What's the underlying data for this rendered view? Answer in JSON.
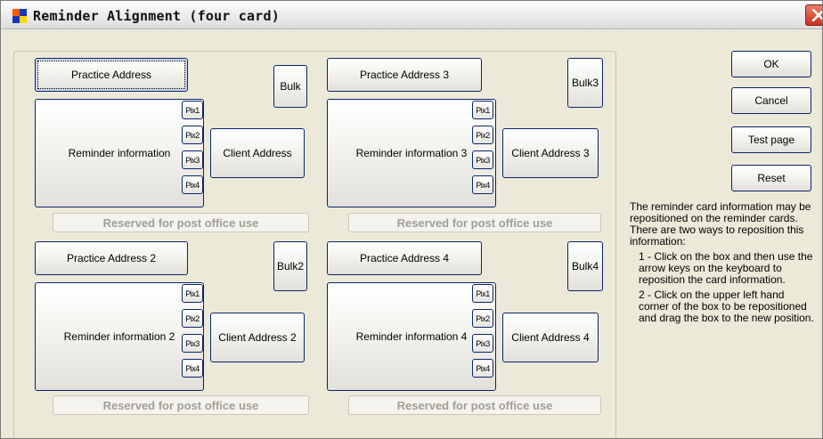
{
  "window": {
    "title": "Reminder Alignment (four card)"
  },
  "cards": [
    {
      "practice_address": "Practice Address",
      "bulk": "Bulk",
      "reminder_info": "Reminder information",
      "client_address": "Client Address",
      "pix": [
        "Pix1",
        "Pix2",
        "Pix3",
        "Pix4"
      ],
      "reserved": "Reserved for post office use"
    },
    {
      "practice_address": "Practice Address 3",
      "bulk": "Bulk3",
      "reminder_info": "Reminder information 3",
      "client_address": "Client Address 3",
      "pix": [
        "Pix1",
        "Pix2",
        "Pix3",
        "Pix4"
      ],
      "reserved": "Reserved for post office use"
    },
    {
      "practice_address": "Practice Address 2",
      "bulk": "Bulk2",
      "reminder_info": "Reminder information 2",
      "client_address": "Client Address 2",
      "pix": [
        "Pix1",
        "Pix2",
        "Pix3",
        "Pix4"
      ],
      "reserved": "Reserved for post office use"
    },
    {
      "practice_address": "Practice Address 4",
      "bulk": "Bulk4",
      "reminder_info": "Reminder information 4",
      "client_address": "Client Address 4",
      "pix": [
        "Pix1",
        "Pix2",
        "Pix3",
        "Pix4"
      ],
      "reserved": "Reserved for post office use"
    }
  ],
  "actions": {
    "ok": "OK",
    "cancel": "Cancel",
    "test_page": "Test page",
    "reset": "Reset"
  },
  "help": {
    "intro": "The reminder card information may be repositioned on the reminder cards. There are two ways to reposition this information:",
    "step1": "1 - Click on the box and then use the arrow keys on the keyboard to reposition the card information.",
    "step2": "2 - Click on the upper left hand corner of the box to be repositioned and drag the box to the new position."
  },
  "icons": {
    "app": "app-icon",
    "close": "close-icon"
  },
  "colors": {
    "close_button": "#c8311c",
    "button_border": "#0a246a",
    "dialog_background": "#ece9d8"
  }
}
